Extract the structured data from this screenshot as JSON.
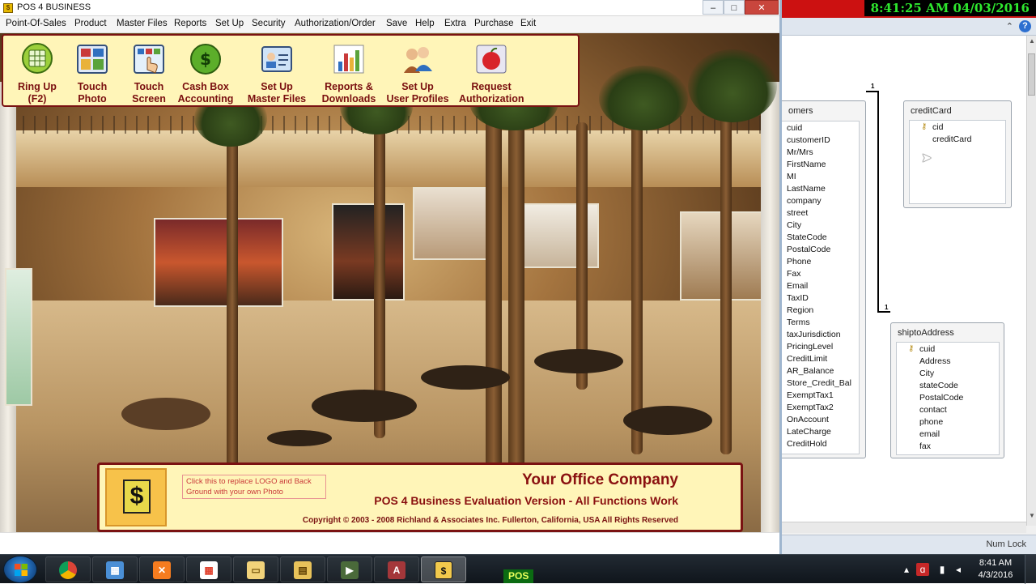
{
  "pos_window": {
    "title": "POS 4 BUSINESS",
    "menu": [
      "Point-Of-Sales",
      "Product",
      "Master Files",
      "Reports",
      "Set Up",
      "Security",
      "Authorization/Order",
      "Save",
      "Help",
      "Extra",
      "Purchase",
      "Exit"
    ],
    "toolbar": [
      {
        "line1": "Ring Up",
        "line2": "(F2)",
        "icon": "cash-register-icon"
      },
      {
        "line1": "Touch",
        "line2": "Photo",
        "icon": "touch-photo-icon"
      },
      {
        "line1": "Touch",
        "line2": "Screen",
        "icon": "touch-screen-icon"
      },
      {
        "line1": "Cash Box",
        "line2": "Accounting",
        "icon": "dollar-coin-icon"
      },
      {
        "line1": "Set Up",
        "line2": "Master Files",
        "icon": "id-card-icon"
      },
      {
        "line1": "Reports &",
        "line2": "Downloads",
        "icon": "bar-chart-icon"
      },
      {
        "line1": "Set Up",
        "line2": "User Profiles",
        "icon": "user-profiles-icon"
      },
      {
        "line1": "Request",
        "line2": "Authorization",
        "icon": "apple-icon"
      }
    ],
    "banner": {
      "logo_hint": "Click this to replace LOGO and Back Ground with your own Photo",
      "company": "Your Office Company",
      "version": "POS 4 Business Evaluation Version - All Functions Work",
      "copyright": "Copyright © 2003 - 2008 Richland & Associates Inc. Fullerton, California, USA All Rights Reserved",
      "logo_symbol": "$"
    }
  },
  "access_window": {
    "clock": "8:41:25 AM 04/03/2016",
    "status": "Num Lock",
    "tables": {
      "customers": {
        "title": "omers",
        "fields": [
          "cuid",
          "customerID",
          "Mr/Mrs",
          "FirstName",
          "MI",
          "LastName",
          "company",
          "street",
          "City",
          "StateCode",
          "PostalCode",
          "Phone",
          "Fax",
          "Email",
          "TaxID",
          "Region",
          "Terms",
          "taxJurisdiction",
          "PricingLevel",
          "CreditLimit",
          "AR_Balance",
          "Store_Credit_Bal",
          "ExemptTax1",
          "ExemptTax2",
          "OnAccount",
          "LateCharge",
          "CreditHold"
        ]
      },
      "creditCard": {
        "title": "creditCard",
        "fields": [
          "cid",
          "creditCard"
        ]
      },
      "shiptoAddress": {
        "title": "shiptoAddress",
        "fields": [
          "cuid",
          "Address",
          "City",
          "stateCode",
          "PostalCode",
          "contact",
          "phone",
          "email",
          "fax"
        ]
      }
    },
    "relationship_labels": [
      "1",
      "1"
    ]
  },
  "taskbar": {
    "pos_label": "POS",
    "time": "8:41 AM",
    "date": "4/3/2016",
    "apps": [
      "explorer",
      "chrome",
      "network",
      "xampp",
      "apps-grid",
      "folder",
      "file-explorer",
      "media",
      "access",
      "pos4business"
    ]
  },
  "colors": {
    "toolbar_bg": "#fff5b8",
    "toolbar_border": "#7a1212",
    "label_red": "#7a0f0f",
    "clock_green": "#2ee82e",
    "top_red": "#cc1111"
  }
}
